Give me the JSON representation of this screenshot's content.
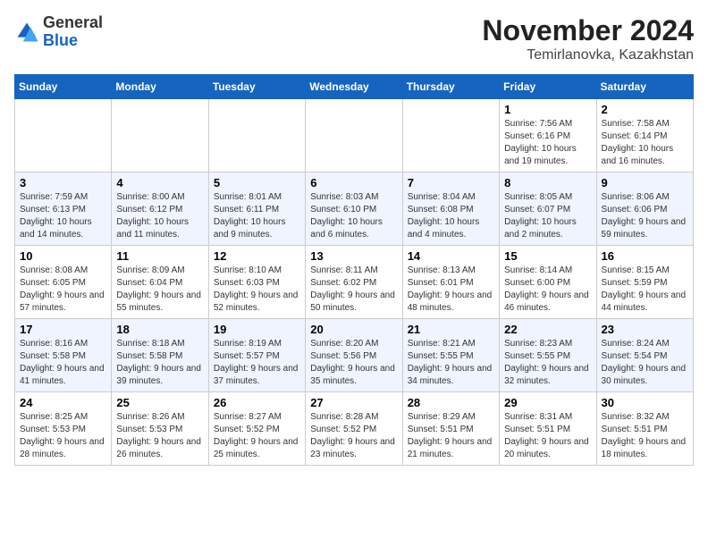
{
  "header": {
    "logo_line1": "General",
    "logo_line2": "Blue",
    "month": "November 2024",
    "location": "Temirlanovka, Kazakhstan"
  },
  "days_of_week": [
    "Sunday",
    "Monday",
    "Tuesday",
    "Wednesday",
    "Thursday",
    "Friday",
    "Saturday"
  ],
  "weeks": [
    [
      {
        "day": "",
        "info": ""
      },
      {
        "day": "",
        "info": ""
      },
      {
        "day": "",
        "info": ""
      },
      {
        "day": "",
        "info": ""
      },
      {
        "day": "",
        "info": ""
      },
      {
        "day": "1",
        "info": "Sunrise: 7:56 AM\nSunset: 6:16 PM\nDaylight: 10 hours and 19 minutes."
      },
      {
        "day": "2",
        "info": "Sunrise: 7:58 AM\nSunset: 6:14 PM\nDaylight: 10 hours and 16 minutes."
      }
    ],
    [
      {
        "day": "3",
        "info": "Sunrise: 7:59 AM\nSunset: 6:13 PM\nDaylight: 10 hours and 14 minutes."
      },
      {
        "day": "4",
        "info": "Sunrise: 8:00 AM\nSunset: 6:12 PM\nDaylight: 10 hours and 11 minutes."
      },
      {
        "day": "5",
        "info": "Sunrise: 8:01 AM\nSunset: 6:11 PM\nDaylight: 10 hours and 9 minutes."
      },
      {
        "day": "6",
        "info": "Sunrise: 8:03 AM\nSunset: 6:10 PM\nDaylight: 10 hours and 6 minutes."
      },
      {
        "day": "7",
        "info": "Sunrise: 8:04 AM\nSunset: 6:08 PM\nDaylight: 10 hours and 4 minutes."
      },
      {
        "day": "8",
        "info": "Sunrise: 8:05 AM\nSunset: 6:07 PM\nDaylight: 10 hours and 2 minutes."
      },
      {
        "day": "9",
        "info": "Sunrise: 8:06 AM\nSunset: 6:06 PM\nDaylight: 9 hours and 59 minutes."
      }
    ],
    [
      {
        "day": "10",
        "info": "Sunrise: 8:08 AM\nSunset: 6:05 PM\nDaylight: 9 hours and 57 minutes."
      },
      {
        "day": "11",
        "info": "Sunrise: 8:09 AM\nSunset: 6:04 PM\nDaylight: 9 hours and 55 minutes."
      },
      {
        "day": "12",
        "info": "Sunrise: 8:10 AM\nSunset: 6:03 PM\nDaylight: 9 hours and 52 minutes."
      },
      {
        "day": "13",
        "info": "Sunrise: 8:11 AM\nSunset: 6:02 PM\nDaylight: 9 hours and 50 minutes."
      },
      {
        "day": "14",
        "info": "Sunrise: 8:13 AM\nSunset: 6:01 PM\nDaylight: 9 hours and 48 minutes."
      },
      {
        "day": "15",
        "info": "Sunrise: 8:14 AM\nSunset: 6:00 PM\nDaylight: 9 hours and 46 minutes."
      },
      {
        "day": "16",
        "info": "Sunrise: 8:15 AM\nSunset: 5:59 PM\nDaylight: 9 hours and 44 minutes."
      }
    ],
    [
      {
        "day": "17",
        "info": "Sunrise: 8:16 AM\nSunset: 5:58 PM\nDaylight: 9 hours and 41 minutes."
      },
      {
        "day": "18",
        "info": "Sunrise: 8:18 AM\nSunset: 5:58 PM\nDaylight: 9 hours and 39 minutes."
      },
      {
        "day": "19",
        "info": "Sunrise: 8:19 AM\nSunset: 5:57 PM\nDaylight: 9 hours and 37 minutes."
      },
      {
        "day": "20",
        "info": "Sunrise: 8:20 AM\nSunset: 5:56 PM\nDaylight: 9 hours and 35 minutes."
      },
      {
        "day": "21",
        "info": "Sunrise: 8:21 AM\nSunset: 5:55 PM\nDaylight: 9 hours and 34 minutes."
      },
      {
        "day": "22",
        "info": "Sunrise: 8:23 AM\nSunset: 5:55 PM\nDaylight: 9 hours and 32 minutes."
      },
      {
        "day": "23",
        "info": "Sunrise: 8:24 AM\nSunset: 5:54 PM\nDaylight: 9 hours and 30 minutes."
      }
    ],
    [
      {
        "day": "24",
        "info": "Sunrise: 8:25 AM\nSunset: 5:53 PM\nDaylight: 9 hours and 28 minutes."
      },
      {
        "day": "25",
        "info": "Sunrise: 8:26 AM\nSunset: 5:53 PM\nDaylight: 9 hours and 26 minutes."
      },
      {
        "day": "26",
        "info": "Sunrise: 8:27 AM\nSunset: 5:52 PM\nDaylight: 9 hours and 25 minutes."
      },
      {
        "day": "27",
        "info": "Sunrise: 8:28 AM\nSunset: 5:52 PM\nDaylight: 9 hours and 23 minutes."
      },
      {
        "day": "28",
        "info": "Sunrise: 8:29 AM\nSunset: 5:51 PM\nDaylight: 9 hours and 21 minutes."
      },
      {
        "day": "29",
        "info": "Sunrise: 8:31 AM\nSunset: 5:51 PM\nDaylight: 9 hours and 20 minutes."
      },
      {
        "day": "30",
        "info": "Sunrise: 8:32 AM\nSunset: 5:51 PM\nDaylight: 9 hours and 18 minutes."
      }
    ]
  ]
}
